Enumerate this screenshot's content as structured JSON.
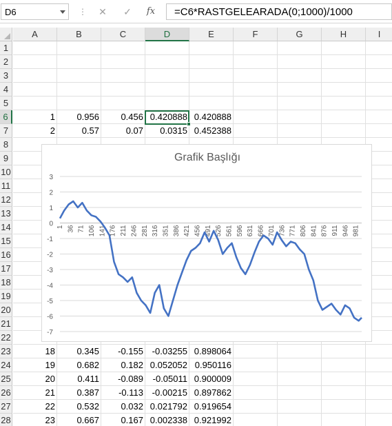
{
  "formula_bar": {
    "name_box": "D6",
    "separator": "⋮",
    "cancel_symbol": "✕",
    "enter_symbol": "✓",
    "fx_symbol": "fx",
    "formula": "=C6*RASTGELEARADA(0;1000)/1000"
  },
  "columns": [
    "A",
    "B",
    "C",
    "D",
    "E",
    "F",
    "G",
    "H",
    "I"
  ],
  "selected_column": "D",
  "rows": [
    "1",
    "2",
    "3",
    "4",
    "5",
    "6",
    "7",
    "8",
    "9",
    "10",
    "11",
    "12",
    "13",
    "14",
    "15",
    "16",
    "17",
    "18",
    "19",
    "20",
    "21",
    "22",
    "23",
    "24",
    "25",
    "26",
    "27",
    "28"
  ],
  "selected_row": "6",
  "cells": [
    {
      "row": "6",
      "values": [
        "1",
        "0.956",
        "0.456",
        "0.420888",
        "0.420888"
      ]
    },
    {
      "row": "7",
      "values": [
        "2",
        "0.57",
        "0.07",
        "0.0315",
        "0.452388"
      ]
    },
    {
      "row": "23",
      "values": [
        "18",
        "0.345",
        "-0.155",
        "-0.03255",
        "0.898064"
      ]
    },
    {
      "row": "24",
      "values": [
        "19",
        "0.682",
        "0.182",
        "0.052052",
        "0.950116"
      ]
    },
    {
      "row": "25",
      "values": [
        "20",
        "0.411",
        "-0.089",
        "-0.05011",
        "0.900009"
      ]
    },
    {
      "row": "26",
      "values": [
        "21",
        "0.387",
        "-0.113",
        "-0.00215",
        "0.897862"
      ]
    },
    {
      "row": "27",
      "values": [
        "22",
        "0.532",
        "0.032",
        "0.021792",
        "0.919654"
      ]
    },
    {
      "row": "28",
      "values": [
        "23",
        "0.667",
        "0.167",
        "0.002338",
        "0.921992"
      ]
    }
  ],
  "chart_data": {
    "type": "line",
    "title": "Grafik Başlığı",
    "xlabel": "",
    "ylabel": "",
    "ylim": [
      -7,
      3
    ],
    "yticks": [
      3,
      2,
      1,
      0,
      -1,
      -2,
      -3,
      -4,
      -5,
      -6,
      -7
    ],
    "x_tick_labels": [
      "1",
      "36",
      "71",
      "106",
      "141",
      "176",
      "211",
      "246",
      "281",
      "316",
      "351",
      "386",
      "421",
      "456",
      "491",
      "526",
      "561",
      "596",
      "631",
      "666",
      "701",
      "736",
      "771",
      "806",
      "841",
      "876",
      "911",
      "946",
      "981"
    ],
    "grid": true,
    "legend": "none",
    "line_color": "#4472c4",
    "series": [
      {
        "x": [
          1,
          15,
          30,
          45,
          60,
          75,
          90,
          105,
          120,
          135,
          150,
          165,
          180,
          195,
          210,
          225,
          240,
          255,
          270,
          285,
          300,
          315,
          330,
          345,
          360,
          375,
          390,
          405,
          420,
          435,
          450,
          465,
          480,
          495,
          510,
          525,
          540,
          555,
          570,
          585,
          600,
          615,
          630,
          645,
          660,
          675,
          690,
          705,
          720,
          735,
          750,
          765,
          780,
          795,
          810,
          825,
          840,
          855,
          870,
          885,
          900,
          915,
          930,
          945,
          960,
          975,
          990,
          1000
        ],
        "values": [
          0.3,
          0.8,
          1.2,
          1.4,
          1.0,
          1.3,
          0.8,
          0.5,
          0.4,
          0.1,
          -0.3,
          -0.8,
          -2.5,
          -3.3,
          -3.5,
          -3.8,
          -3.5,
          -4.5,
          -5.0,
          -5.3,
          -5.8,
          -4.5,
          -4.0,
          -5.5,
          -6.0,
          -5.0,
          -4.0,
          -3.2,
          -2.4,
          -1.8,
          -1.6,
          -1.3,
          -0.6,
          -1.2,
          -0.5,
          -1.1,
          -2.0,
          -1.6,
          -1.3,
          -2.2,
          -2.9,
          -3.3,
          -2.7,
          -1.9,
          -1.2,
          -0.8,
          -1.0,
          -1.4,
          -0.6,
          -1.1,
          -1.5,
          -1.2,
          -1.3,
          -1.7,
          -2.0,
          -3.0,
          -3.7,
          -5.0,
          -5.6,
          -5.4,
          -5.2,
          -5.6,
          -5.9,
          -5.3,
          -5.5,
          -6.1,
          -6.3,
          -6.1
        ]
      }
    ]
  }
}
